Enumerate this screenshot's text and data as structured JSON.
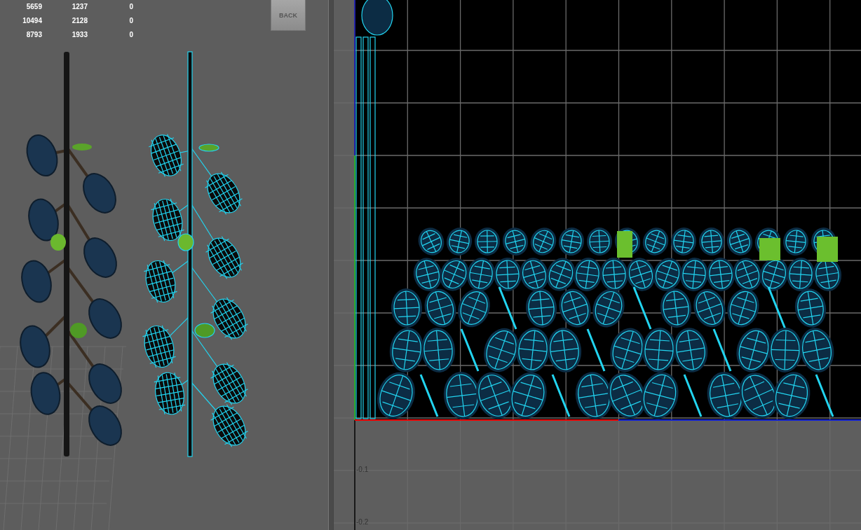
{
  "stats": {
    "rows": [
      [
        "5659",
        "1237",
        "0"
      ],
      [
        "10494",
        "2128",
        "0"
      ],
      [
        "8793",
        "1933",
        "0"
      ]
    ]
  },
  "back_button": {
    "label": "BACK"
  },
  "uv_editor": {
    "axis_labels": [
      "-0.1",
      "-0.2"
    ]
  }
}
